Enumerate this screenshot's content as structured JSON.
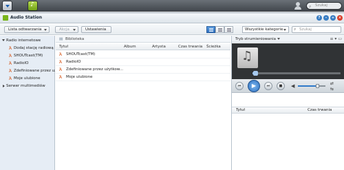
{
  "taskbar": {
    "search_placeholder": "Szukaj"
  },
  "window": {
    "title": "Audio Station"
  },
  "toolbar": {
    "playlist_label": "Lista odtwarzania",
    "action_label": "Akcja",
    "settings_label": "Ustawienia",
    "category_value": "Wszystkie kategorie",
    "search_placeholder": "Szukaj"
  },
  "sidebar": {
    "radio_group": "Radio internetowe",
    "items": [
      {
        "label": "Dodaj stację radiową"
      },
      {
        "label": "SHOUTcast(TM)"
      },
      {
        "label": "RadioIO"
      },
      {
        "label": "Zdefiniowane przez użytkownika"
      },
      {
        "label": "Moje ulubione"
      }
    ],
    "media_group": "Serwer multimediów"
  },
  "library": {
    "breadcrumb": "Biblioteka",
    "columns": [
      "Tytuł",
      "Album",
      "Artysta",
      "Czas trwania",
      "Ścieżka"
    ],
    "rows": [
      "SHOUTcast(TM)",
      "RadioIO",
      "Zdefiniowane przez użytkow...",
      "Moje ulubione"
    ]
  },
  "player": {
    "mode_label": "Tryb strumieniowania",
    "progress": 0.03,
    "volume": 0.7,
    "playlist_columns": [
      "Tytuł",
      "Czas trwania"
    ]
  },
  "colors": {
    "accent": "#2d6fbf",
    "radio_icon": "#d55a1f",
    "sidebar_bg": "#e6edf5"
  }
}
